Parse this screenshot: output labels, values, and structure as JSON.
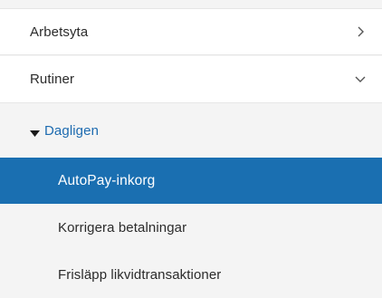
{
  "nav": {
    "items": [
      {
        "label": "Arbetsyta",
        "icon": "chevron-right-icon"
      },
      {
        "label": "Rutiner",
        "icon": "chevron-down-icon"
      }
    ],
    "group": {
      "label": "Dagligen",
      "icon": "caret-down-icon",
      "color": "#1d6bb0"
    },
    "sub_items": [
      {
        "label": "AutoPay-inkorg",
        "selected": true
      },
      {
        "label": "Korrigera betalningar",
        "selected": false
      },
      {
        "label": "Frisläpp likvidtransaktioner",
        "selected": false
      }
    ]
  },
  "colors": {
    "selected_background": "#1a6fb1",
    "panel_background": "#f4f4f4",
    "row_background": "#ffffff",
    "text": "#2b2b2b"
  }
}
